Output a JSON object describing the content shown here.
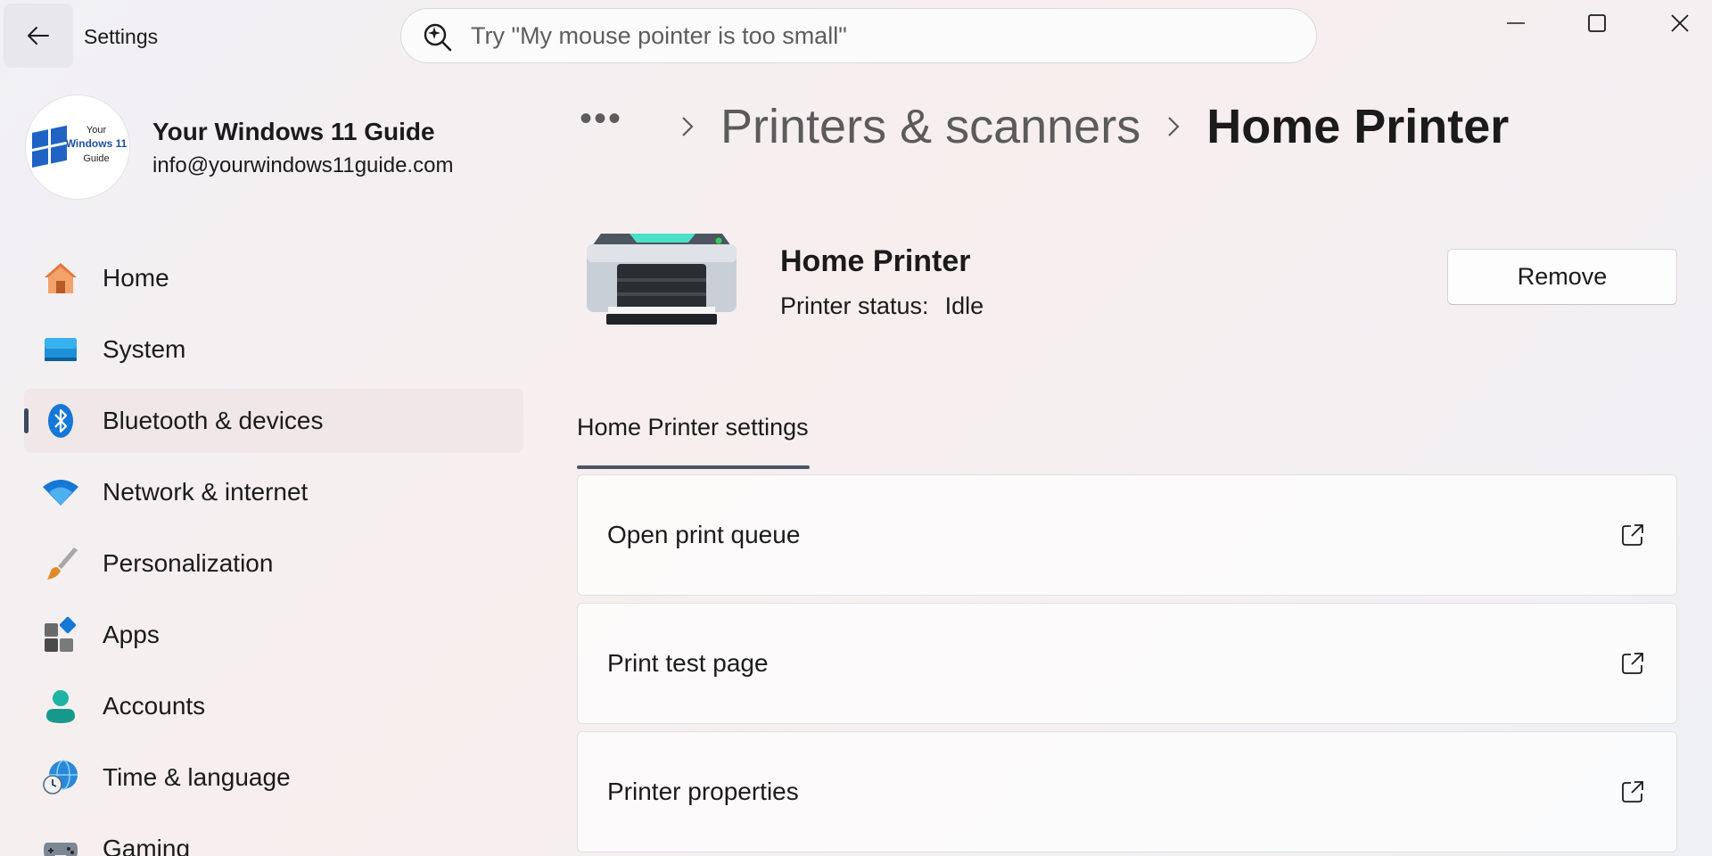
{
  "window": {
    "title": "Settings",
    "controls": [
      "minimize",
      "maximize",
      "close"
    ]
  },
  "search": {
    "placeholder": "Try \"My mouse pointer is too small\"",
    "icon": "search-sparkle-icon"
  },
  "profile": {
    "name": "Your Windows 11 Guide",
    "email": "info@yourwindows11guide.com",
    "logo_text": [
      "Your",
      "Windows 11",
      "Guide"
    ]
  },
  "sidebar": {
    "items": [
      {
        "label": "Home",
        "icon": "home-icon",
        "active": false
      },
      {
        "label": "System",
        "icon": "monitor-icon",
        "active": false
      },
      {
        "label": "Bluetooth & devices",
        "icon": "bluetooth-icon",
        "active": true
      },
      {
        "label": "Network & internet",
        "icon": "wifi-icon",
        "active": false
      },
      {
        "label": "Personalization",
        "icon": "brush-icon",
        "active": false
      },
      {
        "label": "Apps",
        "icon": "apps-icon",
        "active": false
      },
      {
        "label": "Accounts",
        "icon": "person-icon",
        "active": false
      },
      {
        "label": "Time & language",
        "icon": "globe-clock-icon",
        "active": false
      },
      {
        "label": "Gaming",
        "icon": "gamepad-icon",
        "active": false
      }
    ]
  },
  "breadcrumb": {
    "more": "•••",
    "parent": "Printers & scanners",
    "current": "Home Printer"
  },
  "device": {
    "name": "Home Printer",
    "status_label": "Printer status:",
    "status_value": "Idle",
    "remove_label": "Remove"
  },
  "section": {
    "title": "Home Printer settings"
  },
  "settings_cards": [
    {
      "label": "Open print queue",
      "icon": "open-external-icon"
    },
    {
      "label": "Print test page",
      "icon": "open-external-icon"
    },
    {
      "label": "Printer properties",
      "icon": "open-external-icon"
    }
  ],
  "colors": {
    "accent": "#0067c0",
    "active_indicator": "#3a4a5c",
    "active_bg": "#efe7e8"
  }
}
